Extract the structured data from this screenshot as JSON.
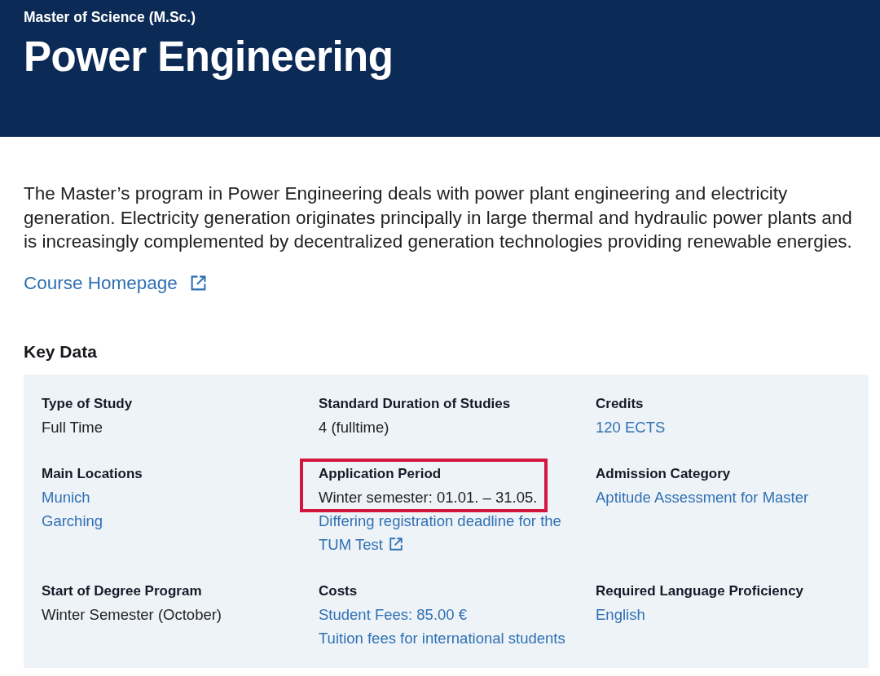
{
  "header": {
    "degree": "Master of Science (M.Sc.)",
    "title": "Power Engineering"
  },
  "description": "The Master’s program in Power Engineering deals with power plant engineering and electricity generation. Electricity generation originates principally in large thermal and hydraulic power plants and is increasingly complemented by decentralized generation technologies providing renewable energies.",
  "homepage_link": {
    "label": "Course Homepage",
    "kind": "external_link"
  },
  "key_data": {
    "heading": "Key Data",
    "items": [
      {
        "label": "Type of Study",
        "highlighted": false,
        "values": [
          {
            "text": "Full Time",
            "kind": "text",
            "highlighted": false
          }
        ]
      },
      {
        "label": "Standard Duration of Studies",
        "highlighted": false,
        "values": [
          {
            "text": "4 (fulltime)",
            "kind": "text",
            "highlighted": false
          }
        ]
      },
      {
        "label": "Credits",
        "highlighted": false,
        "values": [
          {
            "text": "120 ECTS",
            "kind": "link",
            "highlighted": false
          }
        ]
      },
      {
        "label": "Main Locations",
        "highlighted": false,
        "values": [
          {
            "text": "Munich",
            "kind": "link",
            "highlighted": false
          },
          {
            "text": "Garching",
            "kind": "link",
            "highlighted": false
          }
        ]
      },
      {
        "label": "Application Period",
        "highlighted": true,
        "values": [
          {
            "text": "Winter semester: 01.01. – 31.05.",
            "kind": "text",
            "highlighted": true
          },
          {
            "text": "Differing registration deadline for the TUM Test",
            "kind": "external_link",
            "highlighted": false
          }
        ]
      },
      {
        "label": "Admission Category",
        "highlighted": false,
        "values": [
          {
            "text": "Aptitude Assessment for Master",
            "kind": "link",
            "highlighted": false
          }
        ]
      },
      {
        "label": "Start of Degree Program",
        "highlighted": false,
        "values": [
          {
            "text": "Winter Semester (October)",
            "kind": "text",
            "highlighted": false
          }
        ]
      },
      {
        "label": "Costs",
        "highlighted": false,
        "values": [
          {
            "text": "Student Fees: 85.00 €",
            "kind": "link",
            "highlighted": false
          },
          {
            "text": "Tuition fees for international students",
            "kind": "link",
            "highlighted": false
          }
        ]
      },
      {
        "label": "Required Language Proficiency",
        "highlighted": false,
        "values": [
          {
            "text": "English",
            "kind": "link",
            "highlighted": false
          }
        ]
      }
    ]
  }
}
